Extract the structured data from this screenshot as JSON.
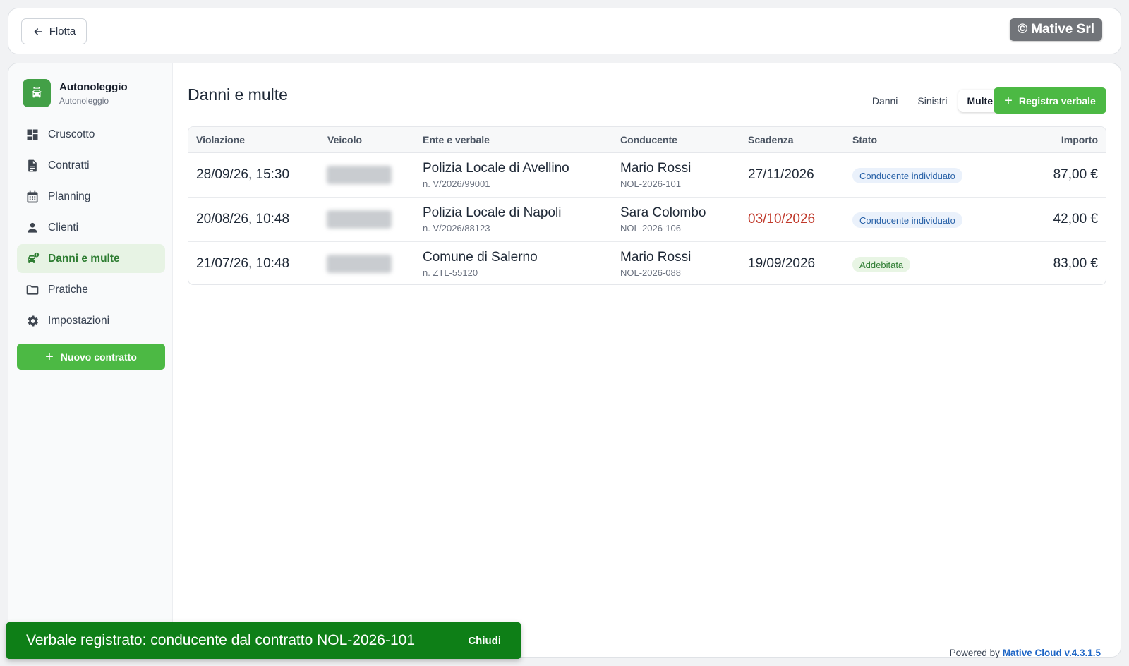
{
  "topbar": {
    "back_label": "Flotta",
    "watermark": "© Mative Srl"
  },
  "sidebar": {
    "brand_title": "Autonoleggio",
    "brand_subtitle": "Autonoleggio",
    "items": [
      {
        "label": "Cruscotto",
        "icon": "dashboard-icon"
      },
      {
        "label": "Contratti",
        "icon": "document-icon"
      },
      {
        "label": "Planning",
        "icon": "calendar-icon"
      },
      {
        "label": "Clienti",
        "icon": "person-icon"
      },
      {
        "label": "Danni e multe",
        "icon": "car-alert-icon",
        "active": true
      },
      {
        "label": "Pratiche",
        "icon": "folder-icon"
      },
      {
        "label": "Impostazioni",
        "icon": "gear-icon"
      }
    ],
    "new_contract_label": "Nuovo contratto"
  },
  "main": {
    "title": "Danni e multe",
    "tabs": [
      {
        "label": "Danni"
      },
      {
        "label": "Sinistri"
      },
      {
        "label": "Multe",
        "active": true
      }
    ],
    "register_label": "Registra verbale"
  },
  "table": {
    "columns": [
      "Violazione",
      "Veicolo",
      "Ente e verbale",
      "Conducente",
      "Scadenza",
      "Stato",
      "Importo"
    ],
    "rows": [
      {
        "violazione": "28/09/26, 15:30",
        "ente": "Polizia Locale di Avellino",
        "verbale": "n. V/2026/99001",
        "conducente": "Mario Rossi",
        "contratto": "NOL-2026-101",
        "scadenza": "27/11/2026",
        "stato": "Conducente individuato",
        "importo": "87,00 €"
      },
      {
        "violazione": "20/08/26, 10:48",
        "ente": "Polizia Locale di Napoli",
        "verbale": "n. V/2026/88123",
        "conducente": "Sara Colombo",
        "contratto": "NOL-2026-106",
        "scadenza": "03/10/2026",
        "stato": "Conducente individuato",
        "importo": "42,00 €"
      },
      {
        "violazione": "21/07/26, 10:48",
        "ente": "Comune di Salerno",
        "verbale": "n. ZTL-55120",
        "conducente": "Mario Rossi",
        "contratto": "NOL-2026-088",
        "scadenza": "19/09/2026",
        "stato": "Addebitata",
        "importo": "83,00 €"
      }
    ]
  },
  "footer": {
    "powered_prefix": "Powered by",
    "powered_brand": "Mative Cloud v.4.3.1.5"
  },
  "toast": {
    "message": "Verbale registrato: conducente dal contratto NOL-2026-101",
    "close_label": "Chiudi"
  },
  "colors": {
    "accent": "#4cb944",
    "active_nav_bg": "#e7f3e4",
    "overdue": "#c0392b",
    "toast_bg": "#0e7f17",
    "badge_blue_text": "#2962a8",
    "badge_green_text": "#2e7d32"
  }
}
